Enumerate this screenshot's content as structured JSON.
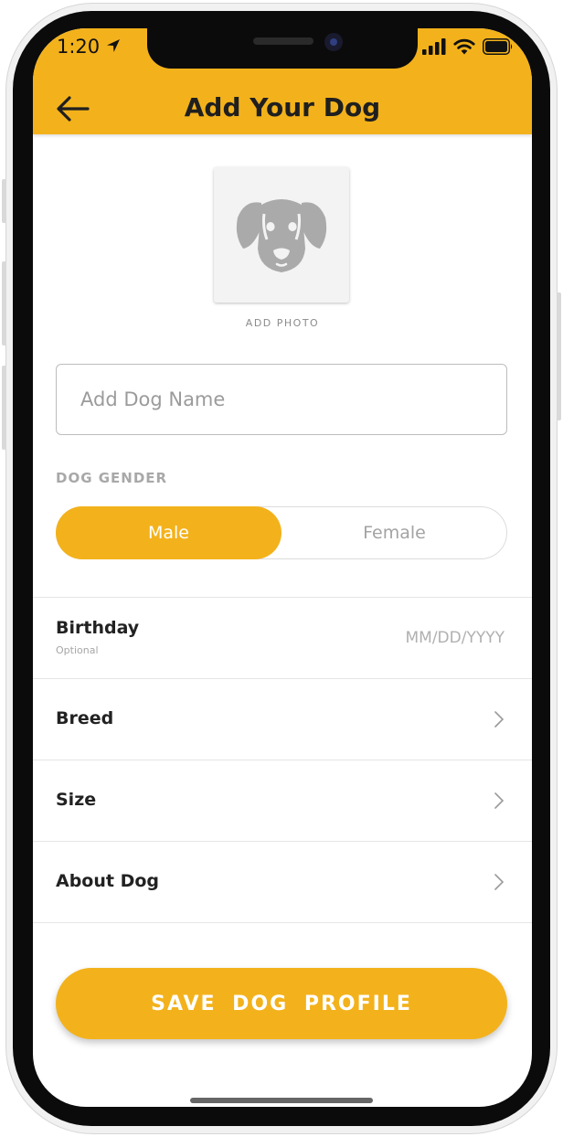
{
  "status_bar": {
    "time": "1:20"
  },
  "header": {
    "title": "Add Your Dog"
  },
  "photo": {
    "label": "ADD PHOTO"
  },
  "name_field": {
    "placeholder": "Add Dog Name",
    "value": ""
  },
  "gender": {
    "label": "DOG GENDER",
    "options": [
      "Male",
      "Female"
    ],
    "selected": "Male"
  },
  "rows": {
    "birthday": {
      "label": "Birthday",
      "sublabel": "Optional",
      "placeholder": "MM/DD/YYYY"
    },
    "breed": {
      "label": "Breed"
    },
    "size": {
      "label": "Size"
    },
    "about": {
      "label": "About Dog"
    }
  },
  "save_button": {
    "label": "SAVE  DOG  PROFILE"
  },
  "colors": {
    "accent": "#f3b21b",
    "icon_gray": "#aaaaaa"
  },
  "icons": [
    "back-arrow-icon",
    "dog-face-icon",
    "chevron-right-icon",
    "location-arrow-icon",
    "signal-icon",
    "wifi-icon",
    "battery-icon"
  ]
}
